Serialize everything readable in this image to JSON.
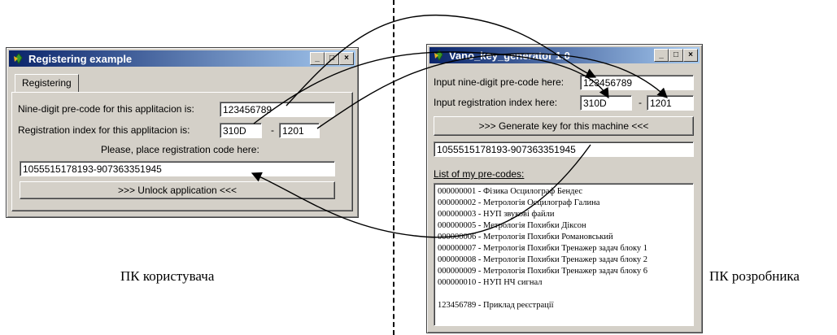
{
  "user_window": {
    "title": "Registering example",
    "tab": "Registering",
    "precode_label": "Nine-digit pre-code for this applitacion is:",
    "precode_value": "123456789",
    "index_label": "Registration index for this applitacion is:",
    "index_part1": "310D",
    "index_sep": "-",
    "index_part2": "1201",
    "place_label": "Please, place registration code here:",
    "code_value": "1055515178193-907363351945",
    "unlock_button": ">>>  Unlock application  <<<"
  },
  "dev_window": {
    "title": "Vano_key_generator  1.0",
    "precode_label": "Input nine-digit pre-code here:",
    "precode_value": "123456789",
    "index_label": "Input registration index here:",
    "index_part1": "310D",
    "index_sep": "-",
    "index_part2": "1201",
    "generate_button": ">>>  Generate key for this machine  <<<",
    "generated_key": "1055515178193-907363351945",
    "list_label": "List of my pre-codes:",
    "precodes": [
      "000000001 - Фізика Осцилограф Бендес",
      "000000002 - Метрологія Осцилограф Галина",
      "000000003 - НУП звукові файли",
      "000000005 - Метрологія Похибки Діксон",
      "000000006 - Метрологія Похибки Романовський",
      "000000007 - Метрологія Похибки Тренажер задач блоку 1",
      "000000008 - Метрологія Похибки Тренажер задач блоку 2",
      "000000009 - Метрологія Похибки Тренажер задач блоку 6",
      "000000010 - НУП НЧ сигнал",
      "",
      "123456789 - Приклад реєстрації"
    ]
  },
  "captions": {
    "user_pc": "ПК користувача",
    "dev_pc": "ПК розробника"
  },
  "window_buttons": {
    "minimize": "_",
    "maximize": "□",
    "close": "×"
  },
  "colors": {
    "titlebar_start": "#0a246a",
    "titlebar_end": "#a6caf0",
    "face": "#d4d0c8"
  }
}
